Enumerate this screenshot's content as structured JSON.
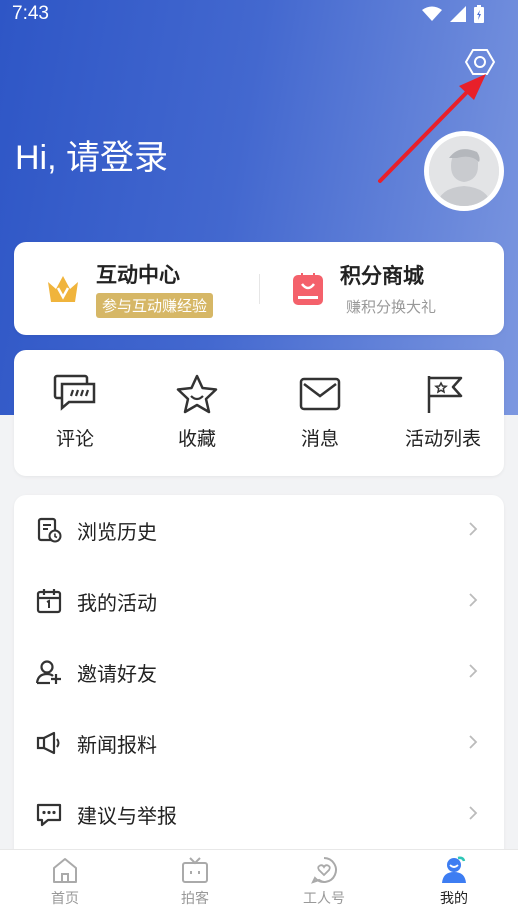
{
  "status_bar": {
    "time": "7:43"
  },
  "header": {
    "greeting": "Hi, 请登录"
  },
  "top_features": [
    {
      "title": "互动中心",
      "subtitle": "参与互动赚经验",
      "icon": "crown-icon"
    },
    {
      "title": "积分商城",
      "subtitle": "赚积分换大礼",
      "icon": "shopping-bag-icon"
    }
  ],
  "quick_actions": [
    {
      "label": "评论",
      "icon": "comment-icon"
    },
    {
      "label": "收藏",
      "icon": "star-icon"
    },
    {
      "label": "消息",
      "icon": "mail-icon"
    },
    {
      "label": "活动列表",
      "icon": "flag-icon"
    }
  ],
  "menu": [
    {
      "label": "浏览历史",
      "icon": "history-icon"
    },
    {
      "label": "我的活动",
      "icon": "calendar-icon"
    },
    {
      "label": "邀请好友",
      "icon": "add-user-icon"
    },
    {
      "label": "新闻报料",
      "icon": "megaphone-icon"
    },
    {
      "label": "建议与举报",
      "icon": "feedback-icon"
    }
  ],
  "tabbar": [
    {
      "label": "首页",
      "icon": "home-icon",
      "active": false
    },
    {
      "label": "拍客",
      "icon": "tv-icon",
      "active": false
    },
    {
      "label": "工人号",
      "icon": "heart-chat-icon",
      "active": false
    },
    {
      "label": "我的",
      "icon": "profile-icon",
      "active": true
    }
  ],
  "colors": {
    "hero_start": "#2e56c6",
    "hero_end": "#7c97e0",
    "badge_gold": "#d6b766",
    "crown_gold": "#f0b43c",
    "bag_red": "#f4616b",
    "active_tab": "#3d7df2",
    "annotation_arrow": "#e8202a"
  }
}
